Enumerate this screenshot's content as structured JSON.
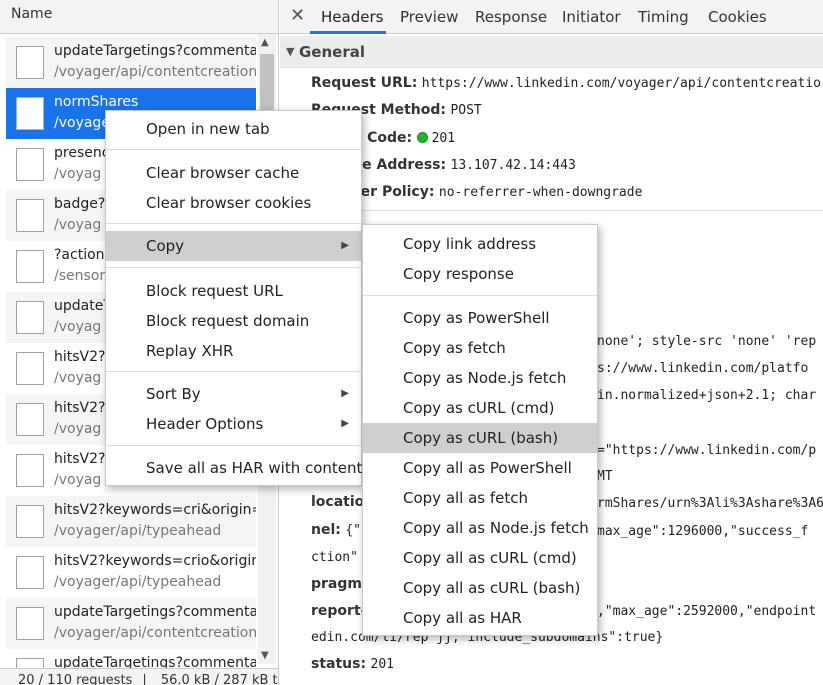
{
  "network_list": {
    "header": "Name",
    "rows": [
      {
        "name": "updateTargetings?commentary",
        "path": "/voyager/api/contentcreation",
        "selected": false
      },
      {
        "name": "normShares",
        "path": "/voyager",
        "selected": true
      },
      {
        "name": "presenc",
        "path": "/voyag",
        "selected": false
      },
      {
        "name": "badge?",
        "path": "/voyag",
        "selected": false
      },
      {
        "name": "?action",
        "path": "/sensor",
        "selected": false
      },
      {
        "name": "updateT",
        "path": "/voyag",
        "selected": false
      },
      {
        "name": "hitsV2?k",
        "path": "/voyag",
        "selected": false
      },
      {
        "name": "hitsV2?k",
        "path": "/voyag",
        "selected": false
      },
      {
        "name": "hitsV2?k",
        "path": "/voyag",
        "selected": false
      },
      {
        "name": "hitsV2?keywords=cri&origin=",
        "path": "/voyager/api/typeahead",
        "selected": false
      },
      {
        "name": "hitsV2?keywords=crio&origin=",
        "path": "/voyager/api/typeahead",
        "selected": false
      },
      {
        "name": "updateTargetings?commentary",
        "path": "/voyager/api/contentcreation",
        "selected": false
      },
      {
        "name": "updateTargetings?commentary",
        "path": "",
        "selected": false
      }
    ],
    "status": {
      "requests": "20 / 110 requests",
      "size": "56.0 kB / 287 kB tr"
    }
  },
  "detail_tabs": {
    "close": "✕",
    "tabs": [
      "Headers",
      "Preview",
      "Response",
      "Initiator",
      "Timing",
      "Cookies"
    ],
    "active": "Headers"
  },
  "general": {
    "title": "General",
    "request_url_label": "Request URL:",
    "request_url_value": "https://www.linkedin.com/voyager/api/contentcreatio",
    "request_method_label": "Request Method:",
    "request_method_value": "POST",
    "status_code_label": "Status Code:",
    "status_code_value": "201",
    "remote_address_label": "Remote Address:",
    "remote_address_value": "13.107.42.14:443",
    "referrer_policy_label": "Referrer Policy:",
    "referrer_policy_value": "no-referrer-when-downgrade"
  },
  "response_headers": {
    "csp_fragment": "none'; style-src 'none' 'rep",
    "link_fragment": "s://www.linkedin.com/platfo",
    "content_type_fragment": "in.normalized+json+2.1; char",
    "header_fragment": "=\"https://www.linkedin.com/p",
    "date_fragment": "MT",
    "location_label": "location",
    "location_value": "rmShares/urn%3Ali%3Ashare%3A6",
    "nel_label": "nel:",
    "nel_value1": "{\"",
    "nel_value2": "max_age\":1296000,\"success_f",
    "nel_cont": "ction\"",
    "pragma_label": "pragma",
    "report_label": "report-",
    "report_value": ",\"max_age\":2592000,\"endpoint",
    "report_cont": "edin.com/li/rep jj, include_subdomains\":true}",
    "status_label": "status:",
    "status_value": "201"
  },
  "context_menu": {
    "items": [
      "Open in new tab",
      "Clear browser cache",
      "Clear browser cookies",
      "Copy",
      "Block request URL",
      "Block request domain",
      "Replay XHR",
      "Sort By",
      "Header Options",
      "Save all as HAR with content"
    ]
  },
  "copy_submenu": {
    "items": [
      "Copy link address",
      "Copy response",
      "Copy as PowerShell",
      "Copy as fetch",
      "Copy as Node.js fetch",
      "Copy as cURL (cmd)",
      "Copy as cURL (bash)",
      "Copy all as PowerShell",
      "Copy all as fetch",
      "Copy all as Node.js fetch",
      "Copy all as cURL (cmd)",
      "Copy all as cURL (bash)",
      "Copy all as HAR"
    ],
    "highlighted": "Copy as cURL (bash)"
  },
  "colors": {
    "accent": "#1a73e8",
    "status_ok": "#26b22f",
    "menu_highlight": "#cfcfcf"
  }
}
